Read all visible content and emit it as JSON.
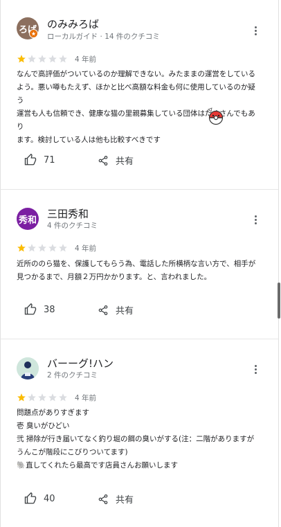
{
  "reviews": [
    {
      "name": "のみみろば",
      "meta": "ローカルガイド · 14 件のクチコミ",
      "avatar_text": "ろば",
      "stars": 1,
      "date": "4 年前",
      "body": "なんで高評価がついているのか理解できない。みたままの運営をしている\nよう。悪い噂もたえず、ほかと比べ高額な料金も何に使用しているのか疑\nう\n運営も人も信頼でき、健康な猫の里親募集している団体はたくさんでもあり\nます。検討している人は他も比較すべきです",
      "likes": "71",
      "share": "共有"
    },
    {
      "name": "三田秀和",
      "meta": "4 件のクチコミ",
      "avatar_text": "秀和",
      "stars": 1,
      "date": "4 年前",
      "body": "近所ののら猫を、保護してもらう為、電話した所横柄な言い方で、相手が\n見つかるまで、月額２万円かかります。と、言われました。",
      "likes": "38",
      "share": "共有"
    },
    {
      "name": "バーーグ!ハン",
      "meta": "2 件のクチコミ",
      "avatar_text": "",
      "stars": 1,
      "date": "4 年前",
      "body": "問題点がありすぎます\n壱 臭いがひどい\n弐 掃除が行き届いてなく釣り堀の餌の臭いがする(注：二階がありますが\nうんこが階段にこびりついてます)\n🐘直してくれたら最高です店員さんお願いします",
      "likes": "40",
      "share": "共有"
    }
  ],
  "colors": {
    "star_filled": "#fbbc04",
    "star_empty": "#dadce0",
    "text": "#202124",
    "meta": "#70757a"
  }
}
